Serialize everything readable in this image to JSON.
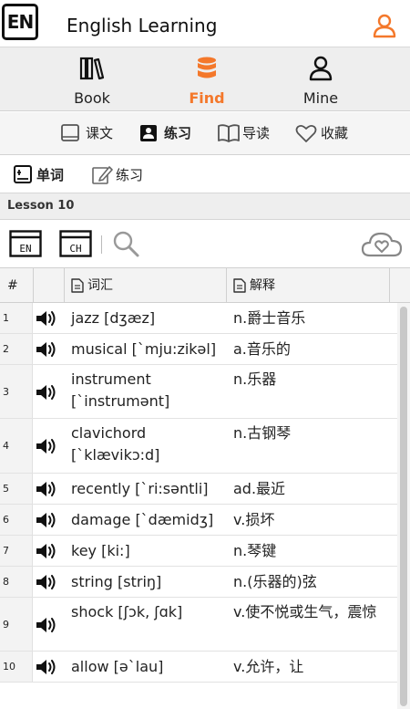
{
  "header": {
    "logo_text": "EN",
    "title": "English Learning",
    "user_icon": "user-icon",
    "accent": "#f4782b"
  },
  "nav": {
    "items": [
      {
        "label": "Book",
        "icon": "book-icon",
        "active": false
      },
      {
        "label": "Find",
        "icon": "database-icon",
        "active": true
      },
      {
        "label": "Mine",
        "icon": "user-icon",
        "active": false
      }
    ]
  },
  "subnav": {
    "items": [
      {
        "label": "课文",
        "icon": "tablet-icon"
      },
      {
        "label": "练习",
        "icon": "contact-card-icon",
        "active": true
      },
      {
        "label": "导读",
        "icon": "open-book-icon"
      },
      {
        "label": "收藏",
        "icon": "heart-icon"
      }
    ]
  },
  "modes": {
    "items": [
      {
        "label": "单词",
        "icon": "word-card-icon",
        "active": true
      },
      {
        "label": "练习",
        "icon": "edit-icon"
      }
    ]
  },
  "lesson": {
    "title": "Lesson 10"
  },
  "tools": {
    "en_label": "EN",
    "ch_label": "CH",
    "search_icon": "search-icon",
    "cloud_icon": "cloud-heart-icon"
  },
  "table": {
    "headers": {
      "index": "#",
      "word": "词汇",
      "meaning": "解释"
    },
    "rows": [
      {
        "index": "1",
        "word": "jazz [dʒæz]",
        "meaning": "n.爵士音乐"
      },
      {
        "index": "2",
        "word": "musical [`mju:zikəl]",
        "meaning": "a.音乐的"
      },
      {
        "index": "3",
        "word": "instrument [`instrumənt]",
        "meaning": "n.乐器"
      },
      {
        "index": "4",
        "word": "clavichord [`klævikɔ:d]",
        "meaning": "n.古钢琴"
      },
      {
        "index": "5",
        "word": "recently [`ri:səntli]",
        "meaning": "ad.最近"
      },
      {
        "index": "6",
        "word": "damage [`dæmidʒ]",
        "meaning": "v.损坏"
      },
      {
        "index": "7",
        "word": "key [ki:]",
        "meaning": "n.琴键"
      },
      {
        "index": "8",
        "word": "string [striŋ]",
        "meaning": "n.(乐器的)弦"
      },
      {
        "index": "9",
        "word": "shock [ʃɔk, ʃɑk]",
        "meaning": "v.使不悦或生气，震惊"
      },
      {
        "index": "10",
        "word": "allow [ə`lau]",
        "meaning": "v.允许，让"
      }
    ]
  }
}
